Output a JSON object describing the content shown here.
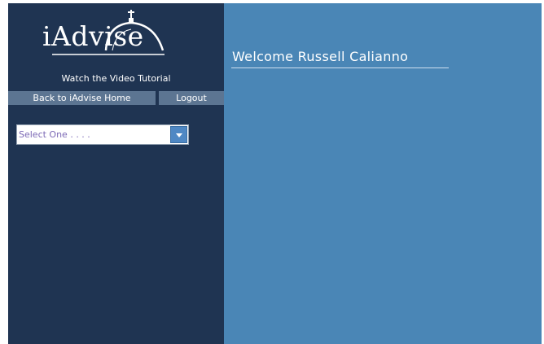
{
  "logo": {
    "text": "iAdvise"
  },
  "sidebar": {
    "tutorial_link": "Watch the Video Tutorial",
    "nav": {
      "home_label": "Back to iAdvise Home",
      "logout_label": "Logout"
    },
    "select": {
      "value": "Select One . . . ."
    }
  },
  "main": {
    "welcome": "Welcome Russell Calianno"
  },
  "colors": {
    "sidebar_bg": "#1f3452",
    "main_bg": "#4a86b6",
    "nav_btn_bg": "#5c7592",
    "select_text": "#7b68b5",
    "select_arrow": "#4f88c4"
  }
}
